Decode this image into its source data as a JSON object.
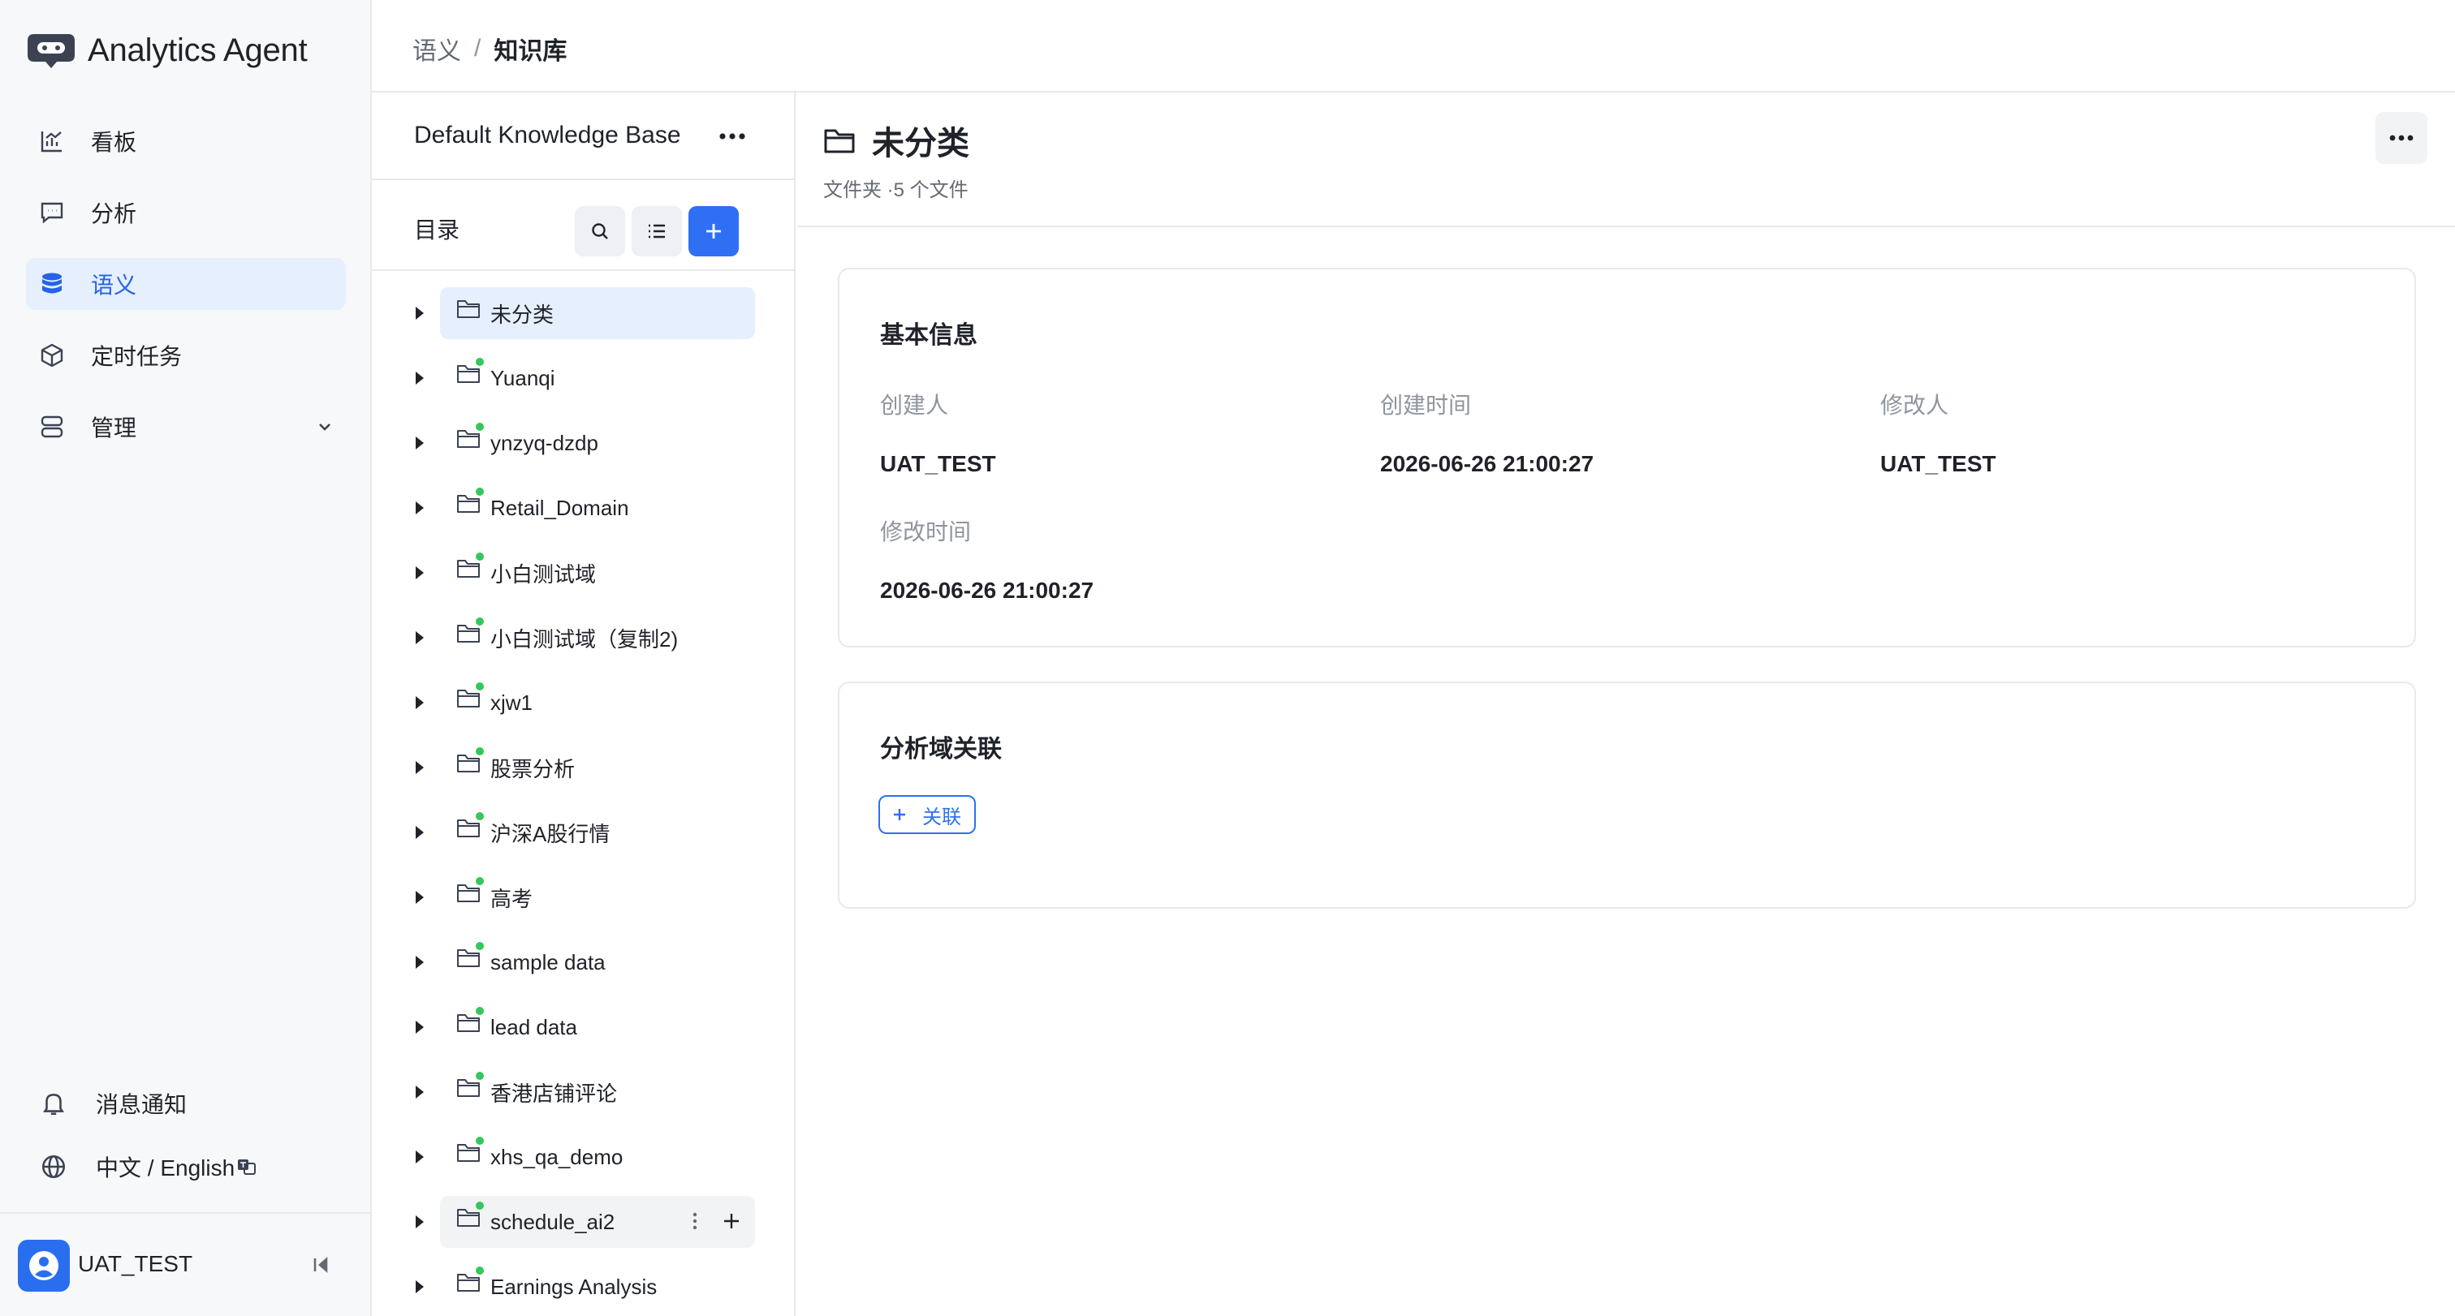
{
  "app": {
    "name": "Analytics Agent"
  },
  "nav": {
    "items": [
      {
        "label": "看板",
        "icon": "chart-icon"
      },
      {
        "label": "分析",
        "icon": "chat-icon"
      },
      {
        "label": "语义",
        "icon": "database-icon",
        "active": true
      },
      {
        "label": "定时任务",
        "icon": "cube-icon"
      },
      {
        "label": "管理",
        "icon": "server-icon",
        "expandable": true
      }
    ]
  },
  "footer": {
    "notifications": "消息通知",
    "language": "中文 / English",
    "user": "UAT_TEST"
  },
  "breadcrumb": {
    "parent": "语义",
    "separator": "/",
    "current": "知识库"
  },
  "directory": {
    "kb_name": "Default Knowledge Base",
    "label": "目录",
    "items": [
      {
        "name": "未分类",
        "status_dot": false,
        "selected": true
      },
      {
        "name": "Yuanqi",
        "status_dot": true
      },
      {
        "name": "ynzyq-dzdp",
        "status_dot": true
      },
      {
        "name": "Retail_Domain",
        "status_dot": true
      },
      {
        "name": "小白测试域",
        "status_dot": true
      },
      {
        "name": "小白测试域（复制2)",
        "status_dot": true
      },
      {
        "name": "xjw1",
        "status_dot": true
      },
      {
        "name": "股票分析",
        "status_dot": true
      },
      {
        "name": "沪深A股行情",
        "status_dot": true
      },
      {
        "name": "高考",
        "status_dot": true
      },
      {
        "name": "sample data",
        "status_dot": true
      },
      {
        "name": "lead data",
        "status_dot": true
      },
      {
        "name": "香港店铺评论",
        "status_dot": true
      },
      {
        "name": "xhs_qa_demo",
        "status_dot": true
      },
      {
        "name": "schedule_ai2",
        "status_dot": true,
        "hovered": true
      },
      {
        "name": "Earnings Analysis",
        "status_dot": true
      }
    ]
  },
  "detail": {
    "title": "未分类",
    "meta": "文件夹 ·5 个文件",
    "basic_info": {
      "title": "基本信息",
      "creator_label": "创建人",
      "creator": "UAT_TEST",
      "created_label": "创建时间",
      "created": "2026-06-26 21:00:27",
      "modifier_label": "修改人",
      "modifier": "UAT_TEST",
      "modified_label": "修改时间",
      "modified": "2026-06-26 21:00:27"
    },
    "domain_link": {
      "title": "分析域关联",
      "button": "关联"
    }
  },
  "colors": {
    "accent": "#2f6ff3",
    "active_bg": "#e6effd",
    "status_dot": "#34c759"
  }
}
